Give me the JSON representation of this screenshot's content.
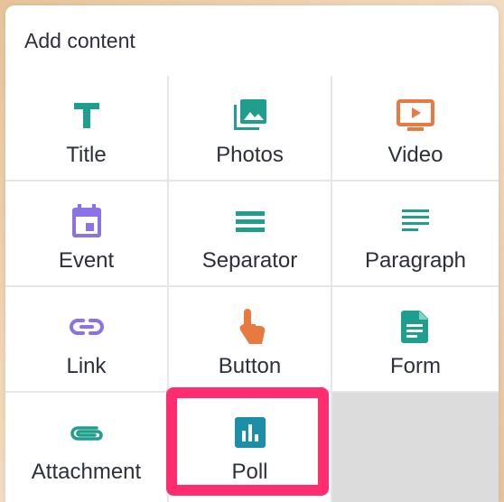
{
  "header": {
    "title": "Add content"
  },
  "items": [
    {
      "label": "Title",
      "icon": "title-icon",
      "color": "#1f9e8e"
    },
    {
      "label": "Photos",
      "icon": "photos-icon",
      "color": "#1f9e8e"
    },
    {
      "label": "Video",
      "icon": "video-icon",
      "color": "#e8793f"
    },
    {
      "label": "Event",
      "icon": "event-icon",
      "color": "#8b72e6"
    },
    {
      "label": "Separator",
      "icon": "separator-icon",
      "color": "#1f9e8e"
    },
    {
      "label": "Paragraph",
      "icon": "paragraph-icon",
      "color": "#1f9e8e"
    },
    {
      "label": "Link",
      "icon": "link-icon",
      "color": "#8b72e6"
    },
    {
      "label": "Button",
      "icon": "button-icon",
      "color": "#e8793f"
    },
    {
      "label": "Form",
      "icon": "form-icon",
      "color": "#1f9e8e"
    },
    {
      "label": "Attachment",
      "icon": "attachment-icon",
      "color": "#1f9e8e"
    },
    {
      "label": "Poll",
      "icon": "poll-icon",
      "color": "#1b8fa8"
    }
  ],
  "highlight": {
    "item": "Poll",
    "color": "#ff2d6f"
  }
}
